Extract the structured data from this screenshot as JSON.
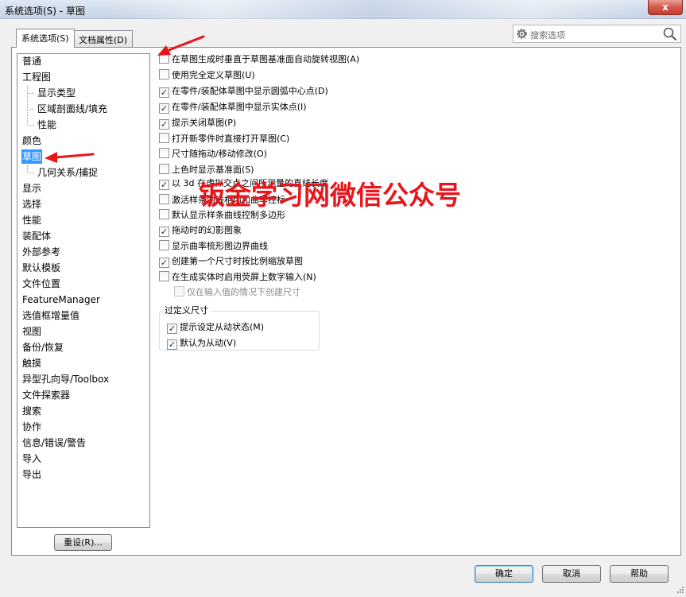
{
  "window": {
    "title": "系统选项(S) - 草图",
    "close_glyph": "x"
  },
  "tabs": [
    {
      "label": "系统选项(S)",
      "active": true
    },
    {
      "label": "文档属性(D)",
      "active": false
    }
  ],
  "search": {
    "placeholder": "搜索选项",
    "gear_icon": "gear-icon",
    "search_icon": "search-icon"
  },
  "tree": {
    "items": [
      {
        "label": "普通",
        "level": 0,
        "selected": false
      },
      {
        "label": "工程图",
        "level": 0,
        "selected": false
      },
      {
        "label": "显示类型",
        "level": 1,
        "selected": false
      },
      {
        "label": "区域剖面线/填充",
        "level": 1,
        "selected": false
      },
      {
        "label": "性能",
        "level": 1,
        "selected": false
      },
      {
        "label": "颜色",
        "level": 0,
        "selected": false
      },
      {
        "label": "草图",
        "level": 0,
        "selected": true
      },
      {
        "label": "几何关系/捕捉",
        "level": 1,
        "selected": false
      },
      {
        "label": "显示",
        "level": 0,
        "selected": false
      },
      {
        "label": "选择",
        "level": 0,
        "selected": false
      },
      {
        "label": "性能",
        "level": 0,
        "selected": false
      },
      {
        "label": "装配体",
        "level": 0,
        "selected": false
      },
      {
        "label": "外部参考",
        "level": 0,
        "selected": false
      },
      {
        "label": "默认模板",
        "level": 0,
        "selected": false
      },
      {
        "label": "文件位置",
        "level": 0,
        "selected": false
      },
      {
        "label": "FeatureManager",
        "level": 0,
        "selected": false
      },
      {
        "label": "选值框增量值",
        "level": 0,
        "selected": false
      },
      {
        "label": "视图",
        "level": 0,
        "selected": false
      },
      {
        "label": "备份/恢复",
        "level": 0,
        "selected": false
      },
      {
        "label": "触摸",
        "level": 0,
        "selected": false
      },
      {
        "label": "异型孔向导/Toolbox",
        "level": 0,
        "selected": false
      },
      {
        "label": "文件探索器",
        "level": 0,
        "selected": false
      },
      {
        "label": "搜索",
        "level": 0,
        "selected": false
      },
      {
        "label": "协作",
        "level": 0,
        "selected": false
      },
      {
        "label": "信息/错误/警告",
        "level": 0,
        "selected": false
      },
      {
        "label": "导入",
        "level": 0,
        "selected": false
      },
      {
        "label": "导出",
        "level": 0,
        "selected": false
      }
    ],
    "reset_label": "重设(R)..."
  },
  "options": [
    {
      "label": "在草图生成时垂直于草图基准面自动旋转视图(A)",
      "checked": false,
      "indent": false,
      "disabled": false
    },
    {
      "label": "使用完全定义草图(U)",
      "checked": false,
      "indent": false,
      "disabled": false
    },
    {
      "label": "在零件/装配体草图中显示圆弧中心点(D)",
      "checked": true,
      "indent": false,
      "disabled": false
    },
    {
      "label": "在零件/装配体草图中显示实体点(I)",
      "checked": true,
      "indent": false,
      "disabled": false
    },
    {
      "label": "提示关闭草图(P)",
      "checked": true,
      "indent": false,
      "disabled": false
    },
    {
      "label": "打开新零件时直接打开草图(C)",
      "checked": false,
      "indent": false,
      "disabled": false
    },
    {
      "label": "尺寸随拖动/移动修改(O)",
      "checked": false,
      "indent": false,
      "disabled": false
    },
    {
      "label": "上色时显示基准面(S)",
      "checked": false,
      "indent": false,
      "disabled": false
    },
    {
      "label": "以 3d 在虚拟交点之间所测量的直线长度",
      "checked": true,
      "indent": false,
      "disabled": false
    },
    {
      "label": "激活样条曲线相切和曲率控标",
      "checked": false,
      "indent": false,
      "disabled": false
    },
    {
      "label": "默认显示样条曲线控制多边形",
      "checked": false,
      "indent": false,
      "disabled": false
    },
    {
      "label": "拖动时的幻影图象",
      "checked": true,
      "indent": false,
      "disabled": false
    },
    {
      "label": "显示曲率梳形图边界曲线",
      "checked": false,
      "indent": false,
      "disabled": false
    },
    {
      "label": "创建第一个尺寸时按比例缩放草图",
      "checked": true,
      "indent": false,
      "disabled": false
    },
    {
      "label": "在生成实体时启用荧屏上数字输入(N)",
      "checked": false,
      "indent": false,
      "disabled": false
    },
    {
      "label": "仅在输入值的情况下创建尺寸",
      "checked": false,
      "indent": true,
      "disabled": true
    }
  ],
  "overdefine_group": {
    "title": "过定义尺寸",
    "options": [
      {
        "label": "提示设定从动状态(M)",
        "checked": true
      },
      {
        "label": "默认为从动(V)",
        "checked": true
      }
    ]
  },
  "watermark": "钣金学习网微信公众号",
  "buttons": {
    "ok": "确定",
    "cancel": "取消",
    "help": "帮助"
  },
  "colors": {
    "selection": "#3399ff",
    "annotation_red": "#e8151b"
  }
}
